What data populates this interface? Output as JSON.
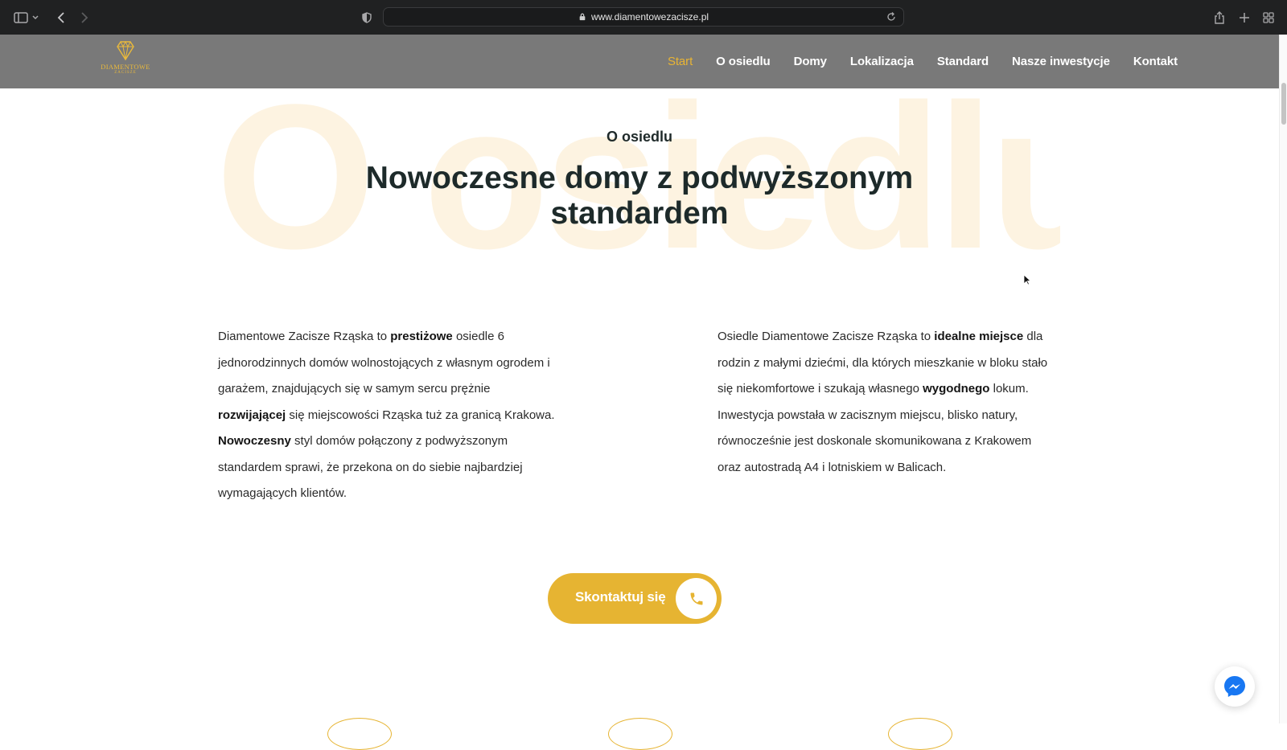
{
  "browser": {
    "url": "www.diamentowezacisze.pl"
  },
  "header": {
    "logo_text": "DIAMENTOWE",
    "logo_sub": "ZACISZE",
    "nav": [
      {
        "label": "Start",
        "active": true
      },
      {
        "label": "O osiedlu",
        "active": false
      },
      {
        "label": "Domy",
        "active": false
      },
      {
        "label": "Lokalizacja",
        "active": false
      },
      {
        "label": "Standard",
        "active": false
      },
      {
        "label": "Nasze inwestycje",
        "active": false
      },
      {
        "label": "Kontakt",
        "active": false
      }
    ]
  },
  "section": {
    "watermark": "O osiedlu",
    "eyebrow": "O osiedlu",
    "headline": "Nowoczesne domy z podwyższonym standardem",
    "left_paragraph": [
      {
        "t": "Diamentowe Zacisze Rząska to ",
        "b": false
      },
      {
        "t": "prestiżowe",
        "b": true
      },
      {
        "t": " osiedle 6 jednorodzinnych domów wolnostojących z własnym ogrodem i garażem, znajdujących się w samym sercu prężnie ",
        "b": false
      },
      {
        "t": "rozwijającej",
        "b": true
      },
      {
        "t": " się miejscowości Rząska tuż za granicą Krakowa. ",
        "b": false
      },
      {
        "t": "Nowoczesny",
        "b": true
      },
      {
        "t": " styl domów połączony z podwyższonym standardem sprawi, że przekona on do siebie najbardziej wymagających klientów.",
        "b": false
      }
    ],
    "right_paragraph": [
      {
        "t": "Osiedle Diamentowe Zacisze Rząska to ",
        "b": false
      },
      {
        "t": "idealne miejsce",
        "b": true
      },
      {
        "t": " dla rodzin z małymi dziećmi, dla których mieszkanie w bloku stało się niekomfortowe i szukają własnego ",
        "b": false
      },
      {
        "t": "wygodnego",
        "b": true
      },
      {
        "t": " lokum. Inwestycja powstała w zacisznym miejscu, blisko natury, równocześnie jest doskonale skomunikowana z Krakowem oraz autostradą A4 i lotniskiem w Balicach.",
        "b": false
      }
    ],
    "cta_label": "Skontaktuj się"
  },
  "colors": {
    "accent": "#e6b432",
    "header_bg": "#797979",
    "watermark": "#fdf3e1",
    "messenger": "#1877f2"
  },
  "icons": [
    "sidebar-icon",
    "back-icon",
    "forward-icon",
    "shield-icon",
    "lock-icon",
    "reload-icon",
    "share-icon",
    "new-tab-icon",
    "tabs-grid-icon",
    "phone-icon",
    "messenger-icon"
  ]
}
